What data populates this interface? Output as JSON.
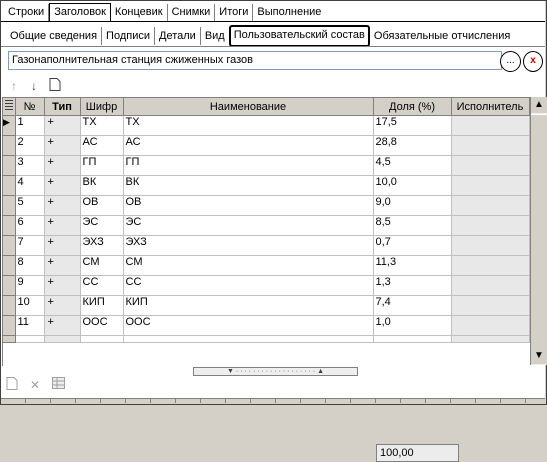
{
  "top_tabs": [
    "Строки",
    "Заголовок",
    "Концевик",
    "Снимки",
    "Итоги",
    "Выполнение"
  ],
  "top_tab_selected": 1,
  "sub_tabs": [
    "Общие сведения",
    "Подписи",
    "Детали",
    "Вид",
    "Пользовательский состав",
    "Обязательные отчисления"
  ],
  "sub_tab_selected": 4,
  "title_value": "Газонаполнительная станция сжиженных газов",
  "title_buttons": {
    "ellipsis": "...",
    "clear": "x"
  },
  "grid": {
    "headers": [
      "№",
      "Тип",
      "Шифр",
      "Наименование",
      "Доля (%)",
      "Исполнитель"
    ],
    "rows": [
      {
        "num": "1",
        "type": "+",
        "code": "ТХ",
        "name": "ТХ",
        "share": "17,5",
        "executor": ""
      },
      {
        "num": "2",
        "type": "+",
        "code": "АС",
        "name": "АС",
        "share": "28,8",
        "executor": ""
      },
      {
        "num": "3",
        "type": "+",
        "code": "ГП",
        "name": "ГП",
        "share": "4,5",
        "executor": ""
      },
      {
        "num": "4",
        "type": "+",
        "code": "ВК",
        "name": "ВК",
        "share": "10,0",
        "executor": ""
      },
      {
        "num": "5",
        "type": "+",
        "code": "ОВ",
        "name": "ОВ",
        "share": "9,0",
        "executor": ""
      },
      {
        "num": "6",
        "type": "+",
        "code": "ЭС",
        "name": "ЭС",
        "share": "8,5",
        "executor": ""
      },
      {
        "num": "7",
        "type": "+",
        "code": "ЭХЗ",
        "name": "ЭХЗ",
        "share": "0,7",
        "executor": ""
      },
      {
        "num": "8",
        "type": "+",
        "code": "СМ",
        "name": "СМ",
        "share": "11,3",
        "executor": ""
      },
      {
        "num": "9",
        "type": "+",
        "code": "СС",
        "name": "СС",
        "share": "1,3",
        "executor": ""
      },
      {
        "num": "10",
        "type": "+",
        "code": "КИП",
        "name": "КИП",
        "share": "7,4",
        "executor": ""
      },
      {
        "num": "11",
        "type": "+",
        "code": "ООС",
        "name": "ООС",
        "share": "1,0",
        "executor": ""
      }
    ],
    "total_share": "100,00",
    "current_row_marker": "▶"
  }
}
